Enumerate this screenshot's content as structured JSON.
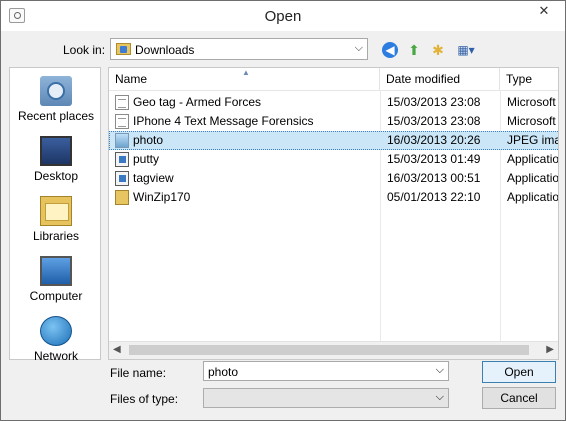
{
  "window": {
    "title": "Open",
    "close_glyph": "✕"
  },
  "lookin": {
    "label": "Look in:",
    "value": "Downloads"
  },
  "toolbar": {
    "icons": [
      "back-icon",
      "up-folder-icon",
      "new-folder-icon",
      "view-menu-icon"
    ]
  },
  "places": [
    {
      "label": "Recent places",
      "icon": "recent-places-icon"
    },
    {
      "label": "Desktop",
      "icon": "desktop-icon"
    },
    {
      "label": "Libraries",
      "icon": "libraries-icon"
    },
    {
      "label": "Computer",
      "icon": "computer-icon"
    },
    {
      "label": "Network",
      "icon": "network-icon"
    }
  ],
  "columns": {
    "name": "Name",
    "date": "Date modified",
    "type": "Type"
  },
  "files": [
    {
      "name": "Geo tag - Armed Forces",
      "date": "15/03/2013 23:08",
      "type": "Microsoft",
      "icon": "text-file-icon",
      "selected": false
    },
    {
      "name": "IPhone 4 Text Message Forensics",
      "date": "15/03/2013 23:08",
      "type": "Microsoft",
      "icon": "text-file-icon",
      "selected": false
    },
    {
      "name": "photo",
      "date": "16/03/2013 20:26",
      "type": "JPEG imag",
      "icon": "image-file-icon",
      "selected": true
    },
    {
      "name": "putty",
      "date": "15/03/2013 01:49",
      "type": "Applicatio",
      "icon": "application-icon",
      "selected": false
    },
    {
      "name": "tagview",
      "date": "16/03/2013 00:51",
      "type": "Applicatio",
      "icon": "application-icon",
      "selected": false
    },
    {
      "name": "WinZip170",
      "date": "05/01/2013 22:10",
      "type": "Applicatio",
      "icon": "folder-icon",
      "selected": false
    }
  ],
  "filename": {
    "label": "File name:",
    "value": "photo"
  },
  "filetype": {
    "label": "Files of type:",
    "value": ""
  },
  "buttons": {
    "open": "Open",
    "cancel": "Cancel"
  },
  "colors": {
    "selection": "#cbe6f7",
    "accent": "#3c7fb1"
  }
}
